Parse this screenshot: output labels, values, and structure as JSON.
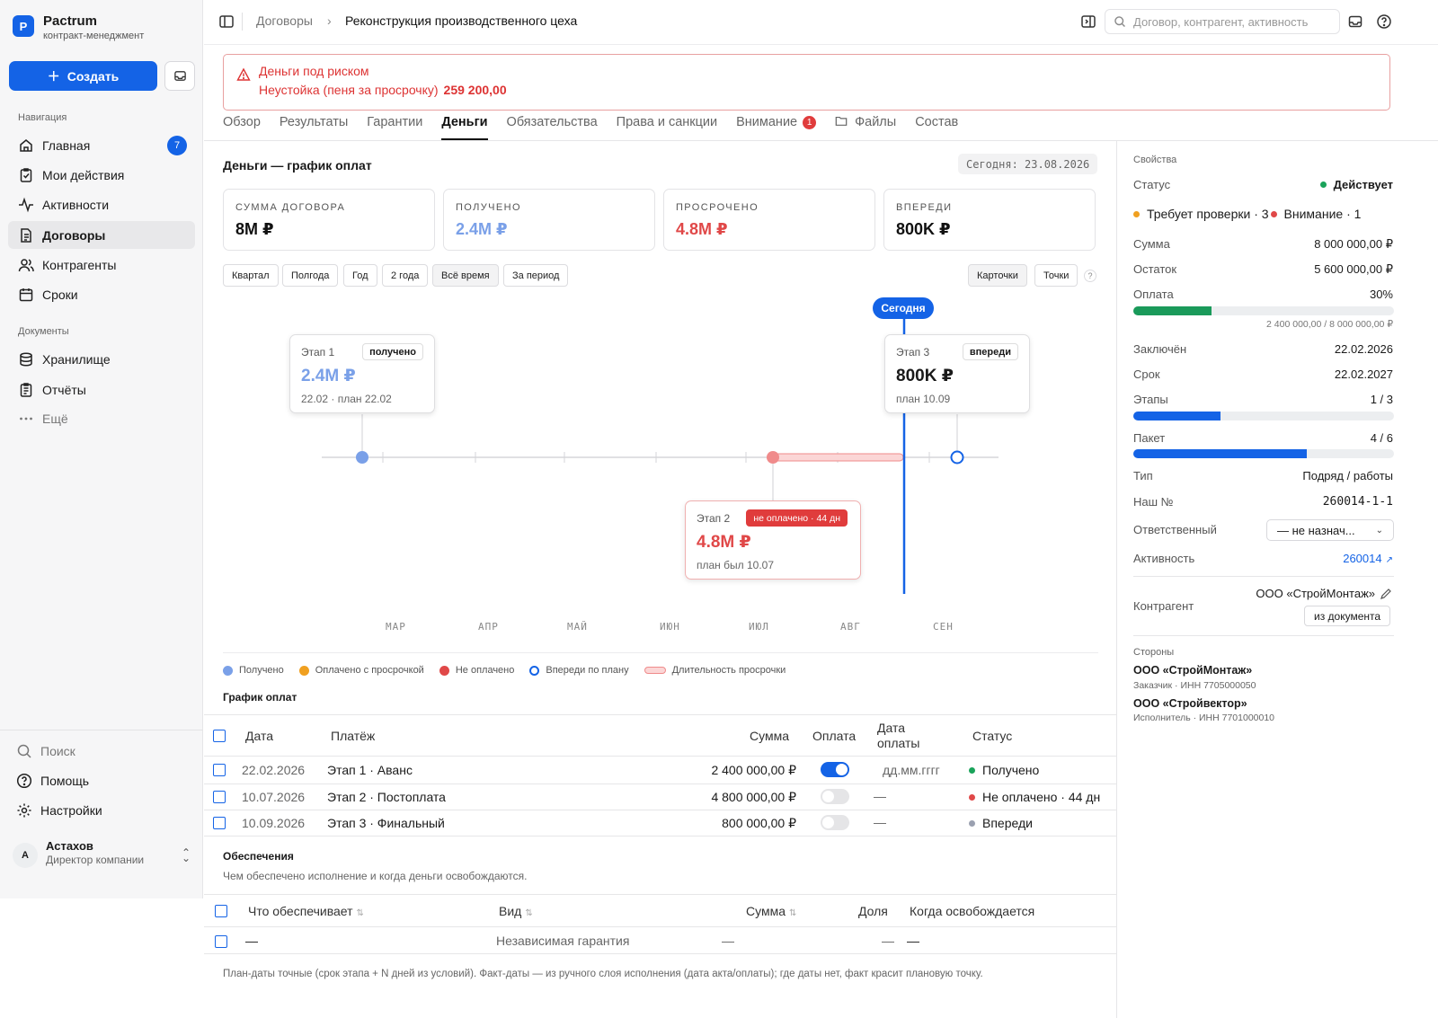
{
  "app": {
    "logo_letter": "P",
    "name": "Pactrum",
    "subtitle": "контракт-менеджмент"
  },
  "sidebar": {
    "create_label": "Создать",
    "nav_heading": "Навигация",
    "nav": [
      {
        "label": "Главная",
        "count": "7"
      },
      {
        "label": "Мои действия"
      },
      {
        "label": "Активности"
      },
      {
        "label": "Договоры"
      },
      {
        "label": "Контрагенты"
      },
      {
        "label": "Сроки"
      }
    ],
    "docs_heading": "Документы",
    "docs": [
      {
        "label": "Хранилище"
      },
      {
        "label": "Отчёты"
      },
      {
        "label": "Ещё"
      }
    ],
    "bottom": [
      {
        "label": "Поиск"
      },
      {
        "label": "Помощь"
      },
      {
        "label": "Настройки"
      }
    ],
    "user": {
      "initial": "А",
      "name": "Астахов",
      "role": "Директор компании"
    }
  },
  "topbar": {
    "breadcrumb": [
      "Договоры",
      "Реконструкция производственного цеха"
    ],
    "search_placeholder": "Договор, контрагент, активность"
  },
  "alert": {
    "title": "Деньги под риском",
    "text": "Неустойка (пеня за просрочку)",
    "amount": "259 200,00"
  },
  "tabs": [
    {
      "label": "Обзор"
    },
    {
      "label": "Результаты"
    },
    {
      "label": "Гарантии"
    },
    {
      "label": "Деньги",
      "active": true
    },
    {
      "label": "Обязательства"
    },
    {
      "label": "Права и санкции"
    },
    {
      "label": "Внимание",
      "badge": "1"
    },
    {
      "label": "Файлы"
    },
    {
      "label": "Состав"
    }
  ],
  "money": {
    "title": "Деньги — график оплат",
    "today": "Сегодня: 23.08.2026",
    "kpis": [
      {
        "label": "СУММА ДОГОВОРА",
        "value": "8M ₽",
        "color": "#111111"
      },
      {
        "label": "ПОЛУЧЕНО",
        "value": "2.4M ₽",
        "color": "#7aa0e8"
      },
      {
        "label": "ПРОСРОЧЕНО",
        "value": "4.8M ₽",
        "color": "#e04848"
      },
      {
        "label": "ВПЕРЕДИ",
        "value": "800K ₽",
        "color": "#111111"
      }
    ],
    "periods": [
      "Квартал",
      "Полгода",
      "Год",
      "2 года",
      "Всё время",
      "За период"
    ],
    "period_selected": "Всё время",
    "views": [
      "Карточки",
      "Точки"
    ],
    "help": "?",
    "timeline": {
      "today_label": "Сегодня",
      "months": [
        "МАР",
        "АПР",
        "МАЙ",
        "ИЮН",
        "ИЮЛ",
        "АВГ",
        "СЕН"
      ],
      "stages": [
        {
          "stage": "Этап 1",
          "badge": "получено",
          "amount": "2.4M ₽",
          "date": "22.02 · план 22.02"
        },
        {
          "stage": "Этап 2",
          "badge": "не оплачено · 44 дн",
          "amount": "4.8M ₽",
          "date": "план был 10.07"
        },
        {
          "stage": "Этап 3",
          "badge": "впереди",
          "amount": "800K ₽",
          "date": "план 10.09"
        }
      ]
    },
    "legend": [
      "Получено",
      "Оплачено с просрочкой",
      "Не оплачено",
      "Впереди по плану",
      "Длительность просрочки"
    ],
    "schedule_title": "График оплат",
    "schedule_headers": [
      "Дата",
      "Платёж",
      "Сумма",
      "Оплата",
      "Дата оплаты",
      "Статус"
    ],
    "schedule_rows": [
      {
        "date": "22.02.2026",
        "payment": "Этап 1 · Аванс",
        "sum": "2 400 000,00 ₽",
        "paid": true,
        "paid_date": "дд.мм.гггг",
        "status": "Получено",
        "status_color": "#1aa35a"
      },
      {
        "date": "10.07.2026",
        "payment": "Этап 2 · Постоплата",
        "sum": "4 800 000,00 ₽",
        "paid": false,
        "paid_date": "—",
        "status": "Не оплачено · 44 дн",
        "status_color": "#e04848"
      },
      {
        "date": "10.09.2026",
        "payment": "Этап 3 · Финальный",
        "sum": "800 000,00 ₽",
        "paid": false,
        "paid_date": "—",
        "status": "Впереди",
        "status_color": "#9aa0b0"
      }
    ],
    "security_title": "Обеспечения",
    "security_sub": "Чем обеспечено исполнение и когда деньги освобождаются.",
    "security_headers": [
      "Что обеспечивает",
      "Вид",
      "Сумма",
      "Доля",
      "Когда освобождается"
    ],
    "security_row": {
      "what": "—",
      "kind": "Независимая гарантия",
      "sum": "—",
      "share": "—",
      "when": "—"
    },
    "footnote": "План-даты точные (срок этапа + N дней из условий). Факт-даты — из ручного слоя исполнения (дата акта/оплаты); где даты нет, факт красит плановую точку."
  },
  "props": {
    "heading": "Свойства",
    "status_label": "Статус",
    "status_value": "Действует",
    "attention": "Требует проверки · 3",
    "attention2": "Внимание · 1",
    "rows": [
      {
        "label": "Сумма",
        "value": "8 000 000,00 ₽"
      },
      {
        "label": "Остаток",
        "value": "5 600 000,00 ₽"
      }
    ],
    "payment_label": "Оплата",
    "payment_value": "30%",
    "payment_fraction": 0.3,
    "payment_sub": "2 400 000,00 / 8 000 000,00 ₽",
    "concluded_label": "Заключён",
    "concluded_value": "22.02.2026",
    "term_label": "Срок",
    "term_value": "22.02.2027",
    "stages_label": "Этапы",
    "stages_value": "1 / 3",
    "stages_fraction": 0.333,
    "package_label": "Пакет",
    "package_value": "4 / 6",
    "package_fraction": 0.667,
    "type_label": "Тип",
    "type_value": "Подряд / работы",
    "our_no_label": "Наш №",
    "our_no_value": "260014-1-1",
    "resp_label": "Ответственный",
    "resp_value": "— не назнач...",
    "activity_label": "Активность",
    "activity_value": "260014",
    "counterparty_label": "Контрагент",
    "counterparty_value": "ООО «СтройМонтаж»",
    "from_doc": "из документа",
    "parties_heading": "Стороны",
    "parties": [
      {
        "name": "ООО «СтройМонтаж»",
        "meta": "Заказчик · ИНН 7705000050"
      },
      {
        "name": "ООО «Стройвектор»",
        "meta": "Исполнитель · ИНН 7701000010"
      }
    ]
  },
  "colors": {
    "accent": "#1463e6",
    "danger": "#e04848",
    "received": "#7aa0e8",
    "late": "#f0a020",
    "success": "#1aa35a"
  }
}
